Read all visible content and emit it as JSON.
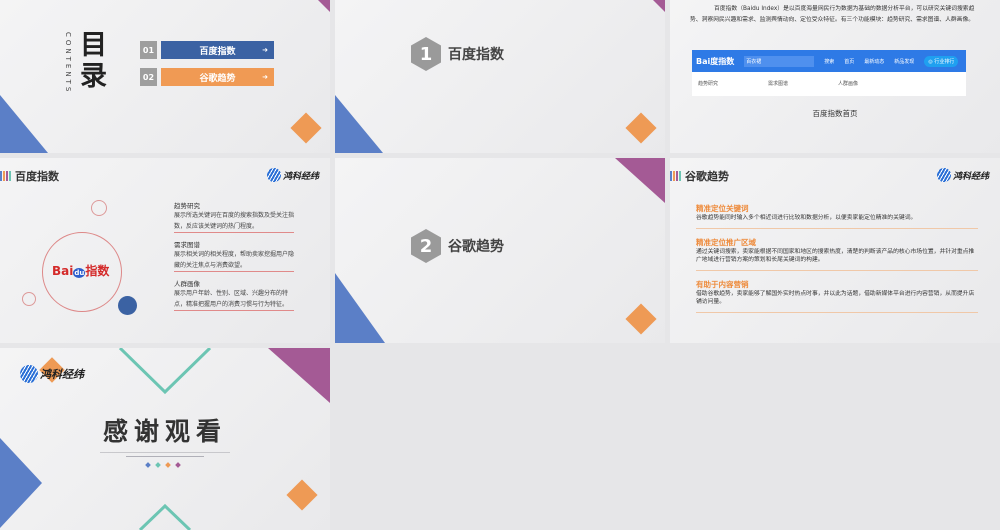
{
  "slides": {
    "toc": {
      "title": "目录",
      "subtitle": "CONTENTS",
      "items": [
        {
          "num": "01",
          "label": "百度指数",
          "color": "#3b62a3"
        },
        {
          "num": "02",
          "label": "谷歌趋势",
          "color": "#f09a54"
        }
      ]
    },
    "section1": {
      "num": "1",
      "title": "百度指数"
    },
    "baidu_intro": {
      "text": "百度指数（Baidu Index）是以百度海量网民行为数据为基础的数据分析平台，可以研究关键词搜索趋势、洞察网民兴趣和需求、监测舆情动向、定位受众特征。有三个功能模块：趋势研究、需求图谱、人群画像。",
      "screenshot": {
        "logo": "Bai度指数",
        "search_placeholder": "百衣裙",
        "search_btn": "搜索",
        "nav": [
          "首页",
          "最新动态",
          "新品发现"
        ],
        "rank_btn": "◎ 行业排行",
        "tabs": [
          "趋势研究",
          "需求图谱",
          "人群画像"
        ]
      },
      "caption": "百度指数首页"
    },
    "baidu_detail": {
      "title": "百度指数",
      "logo_text": "鸿科经纬",
      "badge": {
        "bai": "Bai",
        "du": "du",
        "zhi": "指数"
      },
      "items": [
        {
          "title": "趋势研究",
          "desc": "展示所选关键词在百度的搜索指数及受关注指数，反应该关键词的热门程度。"
        },
        {
          "title": "需求图谱",
          "desc": "展示相关词的相关程度，帮助卖家挖掘用户隐藏的关注焦点与消费欲望。"
        },
        {
          "title": "人群画像",
          "desc": "展示用户年龄、性别、区域、兴趣分布的特点，精准把握用户的消费习惯与行为特征。"
        }
      ]
    },
    "section2": {
      "num": "2",
      "title": "谷歌趋势"
    },
    "google_detail": {
      "title": "谷歌趋势",
      "logo_text": "鸿科经纬",
      "items": [
        {
          "title": "精准定位关键词",
          "desc": "谷歌趋势能同时输入多个相近词进行比较和数据分析，以便卖家能定位精准的关键词。"
        },
        {
          "title": "精准定位推广区域",
          "desc": "通过关键词搜索，卖家能根据不同国家和地区的搜索热度，清楚的判断该产品的核心市场位置，并针对重点推广地域进行营销方案的策划和长尾关键词的构建。"
        },
        {
          "title": "有助于内容营销",
          "desc": "借助谷歌趋势，卖家能够了解国外实时热点时事，并以此为话题，借助新媒体平台进行内容营销，从而提升店铺访问量。"
        }
      ]
    },
    "thanks": {
      "title": "感谢观看",
      "logo_text": "鸿科经纬"
    }
  },
  "colors": {
    "blue": "#5b7fc7",
    "orange": "#ee9a55",
    "purple": "#a45a95",
    "teal": "#6cc5b3"
  }
}
